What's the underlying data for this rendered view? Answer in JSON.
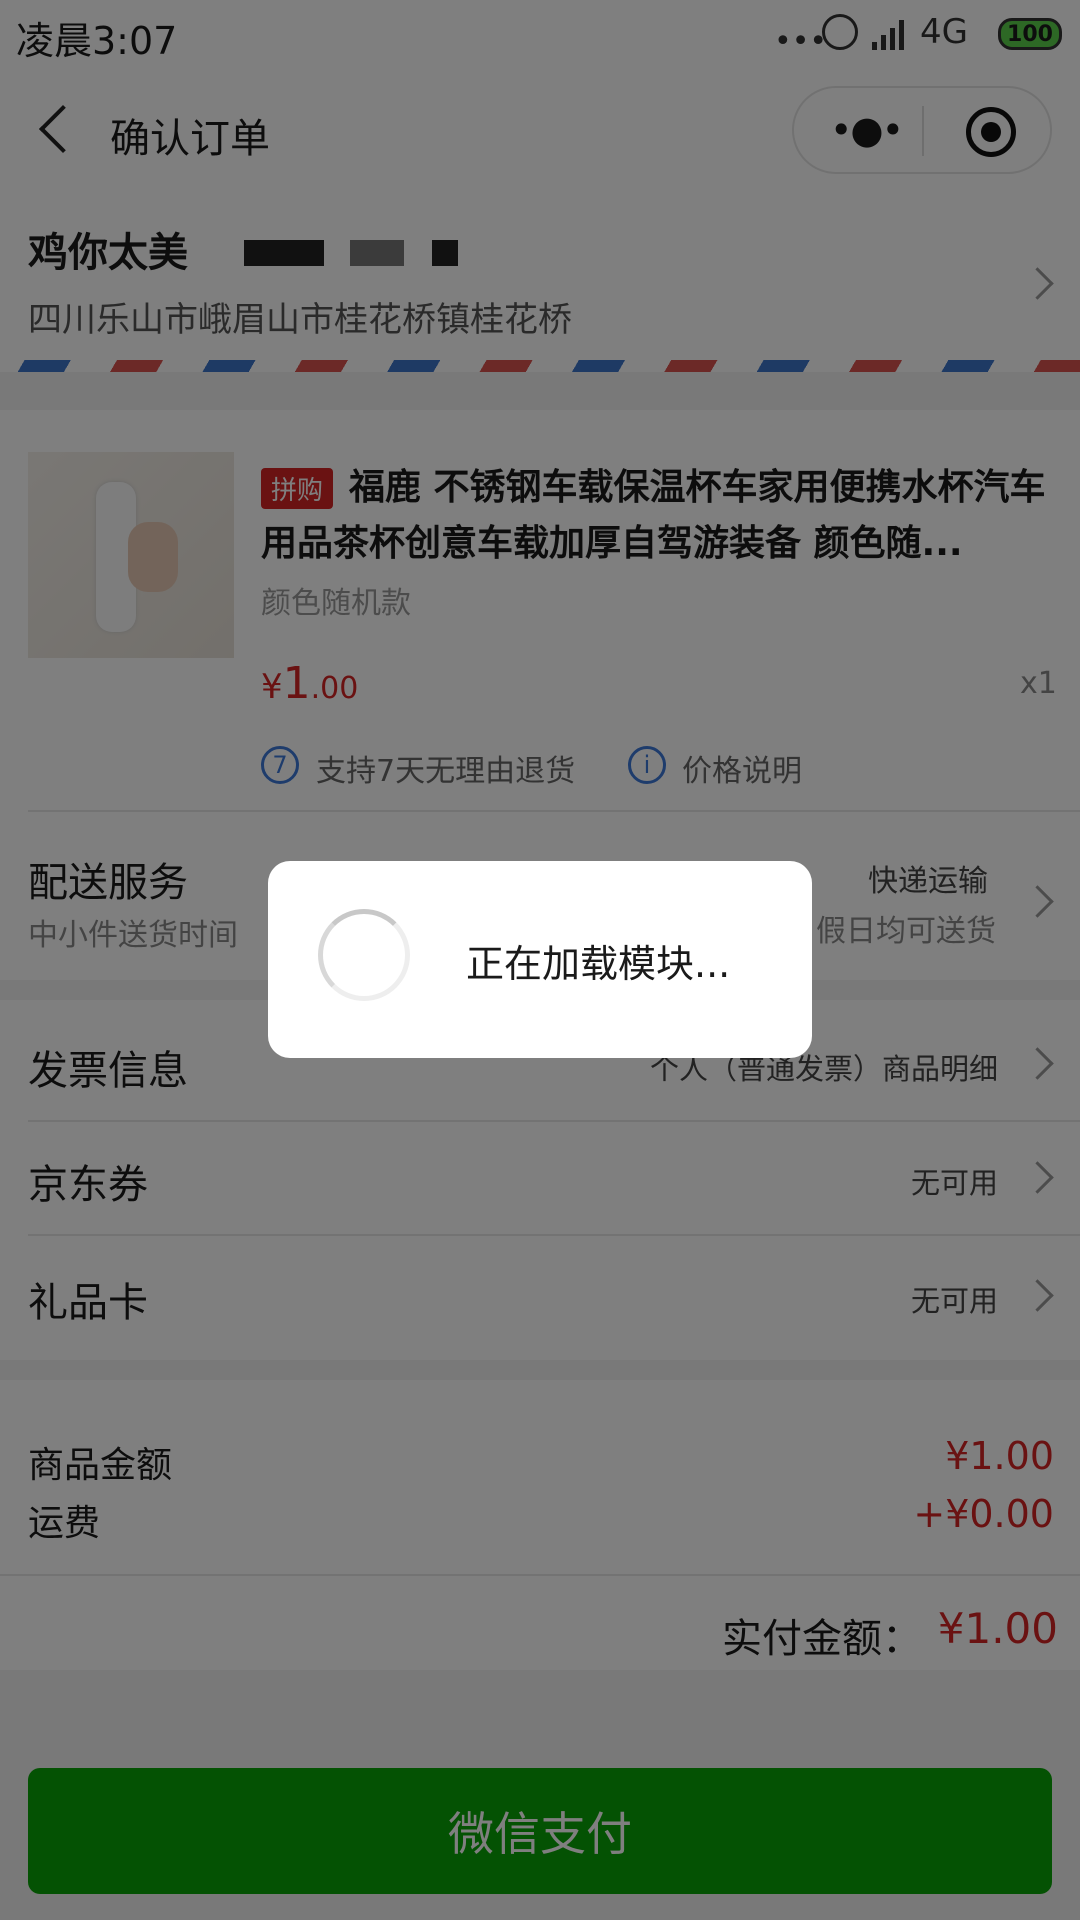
{
  "status_bar": {
    "time": "凌晨3:07",
    "network": "4G",
    "battery": "100"
  },
  "nav": {
    "title": "确认订单",
    "more_icon": "more-dots-icon",
    "close_icon": "target-circle-icon"
  },
  "address": {
    "name": "鸡你太美",
    "detail": "四川乐山市峨眉山市桂花桥镇桂花桥"
  },
  "product": {
    "tag": "拼购",
    "title": "福鹿 不锈钢车载保温杯车家用便携水杯汽车用品茶杯创意车载加厚自驾游装备 颜色随...",
    "variant": "颜色随机款",
    "price_symbol": "¥",
    "price_int": "1",
    "price_dec": ".00",
    "qty": "x1",
    "return_badge": "7",
    "return_text": "支持7天无理由退货",
    "info_badge": "i",
    "info_text": "价格说明"
  },
  "shipping": {
    "title": "配送服务",
    "sub_left": "中小件送货时间",
    "method": "快递运输",
    "sub_right": "假日均可送货"
  },
  "rows": [
    {
      "label": "发票信息",
      "value": "个人（普通发票）商品明细"
    },
    {
      "label": "京东券",
      "value": "无可用"
    },
    {
      "label": "礼品卡",
      "value": "无可用"
    }
  ],
  "summary": {
    "goods_label": "商品金额",
    "goods_value": "¥1.00",
    "freight_label": "运费",
    "freight_value": "+¥0.00",
    "paid_label": "实付金额：",
    "paid_value": "¥1.00"
  },
  "pay_button": "微信支付",
  "toast": {
    "text": "正在加载模块..."
  },
  "colors": {
    "accent_red": "#d42424",
    "pay_green": "#09a406"
  }
}
